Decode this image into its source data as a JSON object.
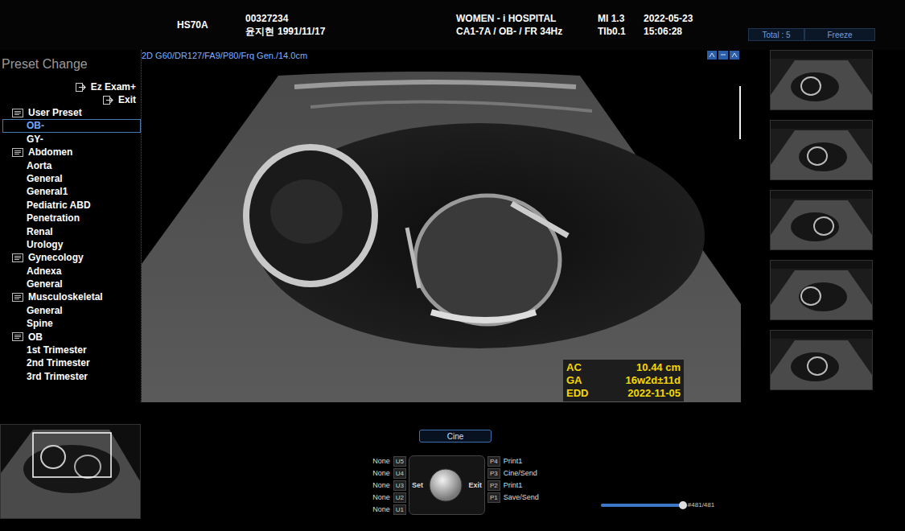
{
  "header": {
    "model": "HS70A",
    "patient_id": "00327234",
    "patient_name": "윤지현",
    "birthdate": "1991/11/17",
    "hospital": "WOMEN - i HOSPITAL",
    "probe": "CA1-7A / OB- / FR 34Hz",
    "mi": "MI 1.3",
    "tib": "TIb0.1",
    "date": "2022-05-23",
    "time": "15:06:28",
    "total": "Total : 5",
    "freeze": "Freeze"
  },
  "preset_panel": {
    "title": "Preset Change",
    "actions": [
      {
        "label": "Ez Exam+"
      },
      {
        "label": "Exit"
      }
    ],
    "items": [
      {
        "label": "User Preset",
        "kind": "header",
        "selected": false
      },
      {
        "label": "OB-",
        "kind": "item",
        "selected": true
      },
      {
        "label": "GY-",
        "kind": "item",
        "selected": false
      },
      {
        "label": "Abdomen",
        "kind": "header",
        "selected": false
      },
      {
        "label": "Aorta",
        "kind": "item",
        "selected": false
      },
      {
        "label": "General",
        "kind": "item",
        "selected": false
      },
      {
        "label": "General1",
        "kind": "item",
        "selected": false
      },
      {
        "label": "Pediatric ABD",
        "kind": "item",
        "selected": false
      },
      {
        "label": "Penetration",
        "kind": "item",
        "selected": false
      },
      {
        "label": "Renal",
        "kind": "item",
        "selected": false
      },
      {
        "label": "Urology",
        "kind": "item",
        "selected": false
      },
      {
        "label": "Gynecology",
        "kind": "header",
        "selected": false
      },
      {
        "label": "Adnexa",
        "kind": "item",
        "selected": false
      },
      {
        "label": "General",
        "kind": "item",
        "selected": false
      },
      {
        "label": "Musculoskeletal",
        "kind": "header",
        "selected": false
      },
      {
        "label": "General",
        "kind": "item",
        "selected": false
      },
      {
        "label": "Spine",
        "kind": "item",
        "selected": false
      },
      {
        "label": "OB",
        "kind": "header",
        "selected": false
      },
      {
        "label": "1st Trimester",
        "kind": "item",
        "selected": false
      },
      {
        "label": "2nd Trimester",
        "kind": "item",
        "selected": false
      },
      {
        "label": "3rd Trimester",
        "kind": "item",
        "selected": false
      }
    ]
  },
  "image": {
    "params": "2D G60/DR127/FA9/P80/Frq Gen./14.0cm",
    "measurements": [
      {
        "label": "AC",
        "value": "10.44 cm"
      },
      {
        "label": "GA",
        "value": "16w2d±11d"
      },
      {
        "label": "EDD",
        "value": "2022-11-05"
      }
    ]
  },
  "thumbnails": [
    {},
    {},
    {},
    {},
    {}
  ],
  "cine": {
    "label": "Cine"
  },
  "user_keys": [
    {
      "value": "None",
      "key": "U5"
    },
    {
      "value": "None",
      "key": "U4"
    },
    {
      "value": "None",
      "key": "U3"
    },
    {
      "value": "None",
      "key": "U2"
    },
    {
      "value": "None",
      "key": "U1"
    }
  ],
  "trackball": {
    "set": "Set",
    "exit": "Exit"
  },
  "print_keys": [
    {
      "key": "P4",
      "label": "Print1"
    },
    {
      "key": "P3",
      "label": "Cine/Send"
    },
    {
      "key": "P2",
      "label": "Print1"
    },
    {
      "key": "P1",
      "label": "Save/Send"
    }
  ],
  "cine_slider": {
    "level": 1.0,
    "reading": "#481/481"
  }
}
